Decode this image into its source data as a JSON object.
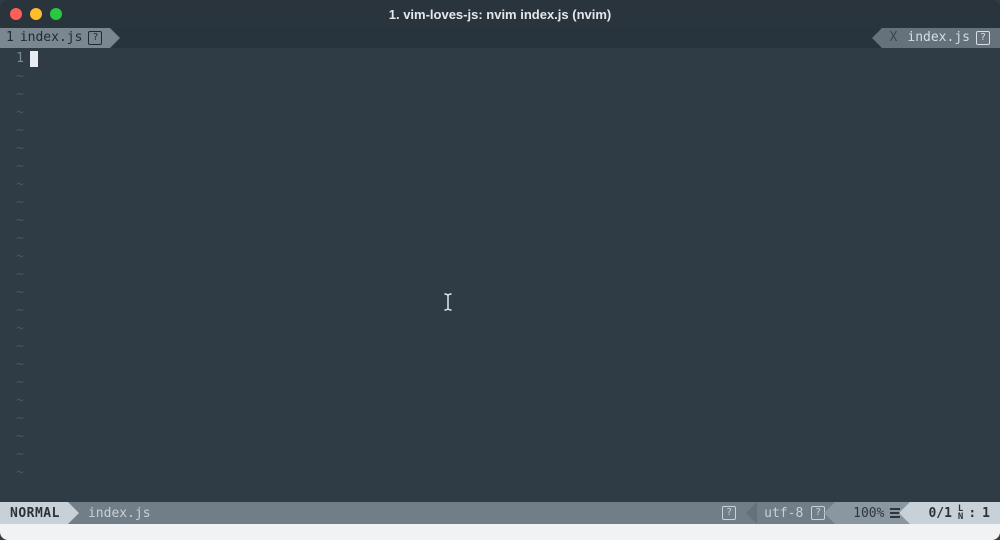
{
  "window": {
    "title": "1. vim-loves-js: nvim index.js (nvim)"
  },
  "tabs": {
    "left": {
      "index": "1",
      "filename": "index.js",
      "badge": "?"
    },
    "right": {
      "close": "X",
      "filename": "index.js",
      "badge": "?"
    }
  },
  "editor": {
    "line_number": "1",
    "tilde_rows": 23
  },
  "status": {
    "mode": "NORMAL",
    "filename": "index.js",
    "filetype_badge": "?",
    "encoding": "utf-8",
    "encoding_badge": "?",
    "percent": "100%",
    "position": "0/1",
    "ln_label": "L\nN",
    "col_sep": ":",
    "col": "1"
  }
}
